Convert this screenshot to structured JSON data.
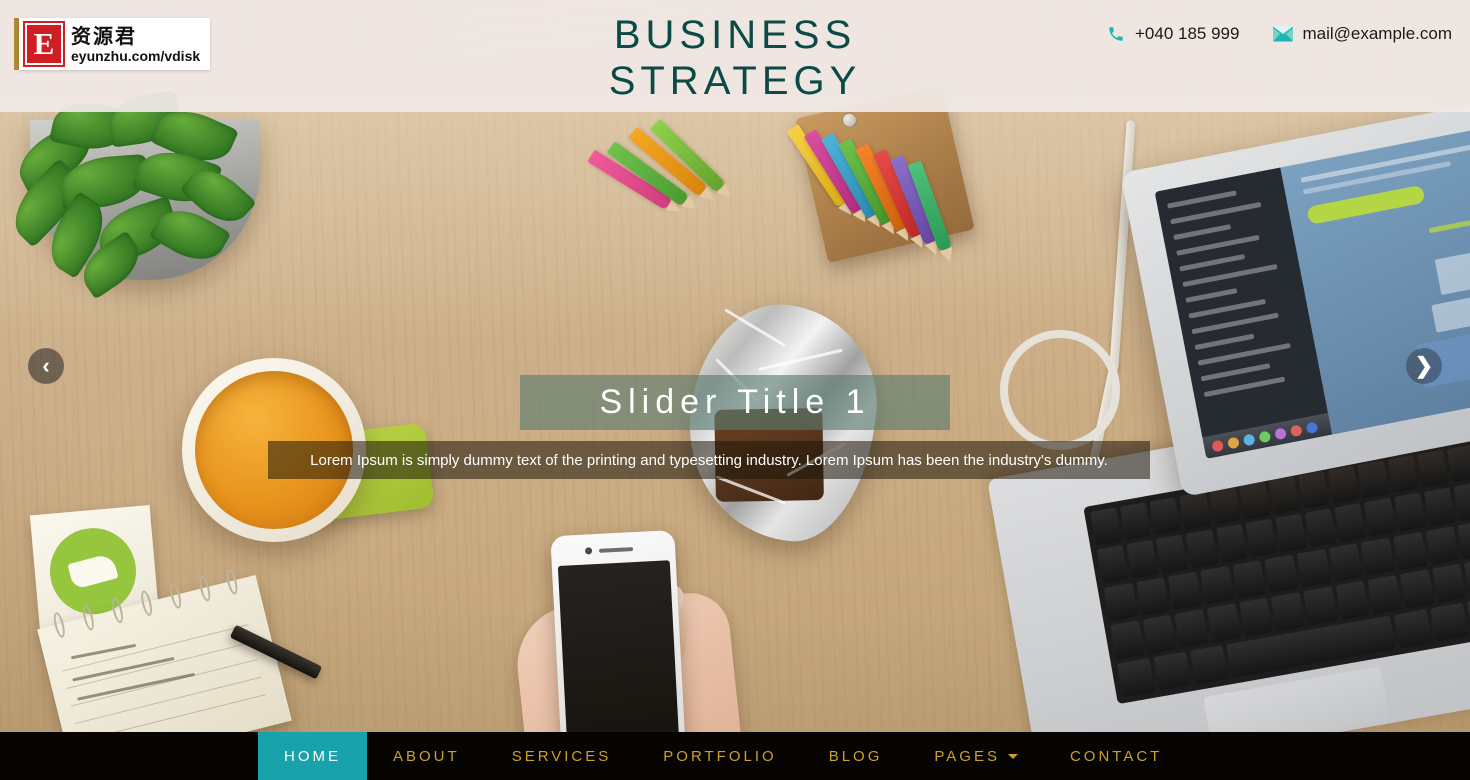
{
  "header": {
    "logo": {
      "letter": "E",
      "chinese": "资源君",
      "url": "eyunzhu.com/vdisk"
    },
    "site_title": "BUSINESS\nSTRATEGY",
    "phone": "+040 185 999",
    "email": "mail@example.com",
    "phone_icon": "phone-icon",
    "email_icon": "envelope-icon",
    "title_color": "#0b4a46",
    "icon_color": "#1fb6b0",
    "background_color": "#f1eae7"
  },
  "slider": {
    "title": "Slider Title 1",
    "description": "Lorem Ipsum is simply dummy text of the printing and typesetting industry. Lorem Ipsum has been the industry's dummy.",
    "prev_arrow": "‹",
    "next_arrow": "❯",
    "title_overlay_color": "#587a70",
    "desc_overlay_color": "#1e160a"
  },
  "nav": {
    "accent_color": "#17a2ac",
    "link_color": "#c9a227",
    "background_color": "#060503",
    "items": [
      {
        "label": "HOME",
        "active": true,
        "dropdown": false
      },
      {
        "label": "ABOUT",
        "active": false,
        "dropdown": false
      },
      {
        "label": "SERVICES",
        "active": false,
        "dropdown": false
      },
      {
        "label": "PORTFOLIO",
        "active": false,
        "dropdown": false
      },
      {
        "label": "BLOG",
        "active": false,
        "dropdown": false
      },
      {
        "label": "PAGES",
        "active": false,
        "dropdown": true
      },
      {
        "label": "CONTACT",
        "active": false,
        "dropdown": false
      }
    ]
  }
}
